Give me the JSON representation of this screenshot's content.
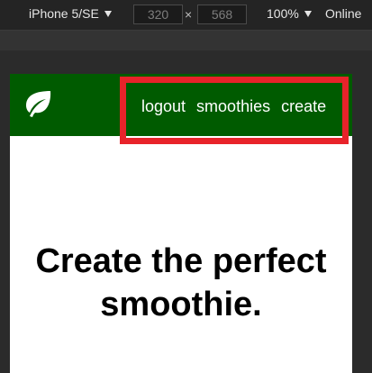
{
  "devtools": {
    "device": "iPhone 5/SE",
    "width": "320",
    "height": "568",
    "times_symbol": "×",
    "zoom": "100%",
    "throttle": "Online"
  },
  "nav": {
    "brand_icon": "leaf-icon",
    "links": [
      "logout",
      "smoothies",
      "create"
    ]
  },
  "hero": {
    "title": "Create the perfect smoothie."
  },
  "colors": {
    "nav_background": "#005b00",
    "highlight": "#e8232a",
    "devtools_background": "#242424"
  }
}
